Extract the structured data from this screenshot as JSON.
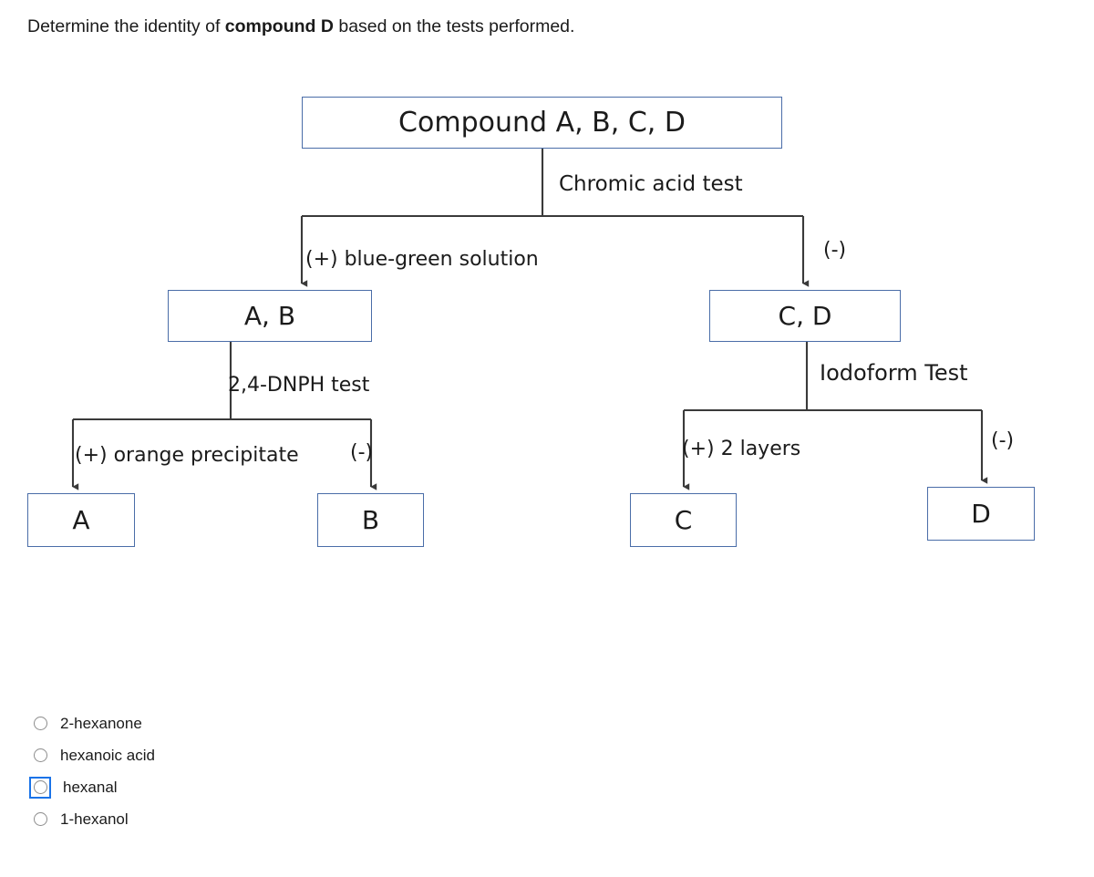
{
  "question": {
    "prefix": "Determine the identity of ",
    "emphasis": "compound D",
    "suffix": " based on the tests performed."
  },
  "flowchart": {
    "nodes": {
      "root": "Compound A, B, C, D",
      "ab": "A, B",
      "cd": "C, D",
      "a": "A",
      "b": "B",
      "c": "C",
      "d": "D"
    },
    "tests": {
      "chromic": "Chromic acid test",
      "dnph": "2,4-DNPH test",
      "iodoform": "Iodoform Test"
    },
    "branch_labels": {
      "blue_green": "(+) blue-green solution",
      "chromic_negative": "(-)",
      "orange_precipitate": "(+) orange precipitate",
      "dnph_negative": "(-)",
      "two_layers": "(+) 2 layers",
      "iodoform_negative": "(-)"
    },
    "colors": {
      "node_border": "#4a6da8",
      "connector": "#3a3a3a",
      "text": "#1b1b1b"
    }
  },
  "answers": {
    "options": [
      {
        "label": "2-hexanone",
        "selected": false,
        "focused": false
      },
      {
        "label": "hexanoic acid",
        "selected": false,
        "focused": false
      },
      {
        "label": "hexanal",
        "selected": false,
        "focused": true
      },
      {
        "label": "1-hexanol",
        "selected": false,
        "focused": false
      }
    ],
    "focus_ring_color": "#1a73e8",
    "radio_border_color": "#8d8d8d"
  }
}
